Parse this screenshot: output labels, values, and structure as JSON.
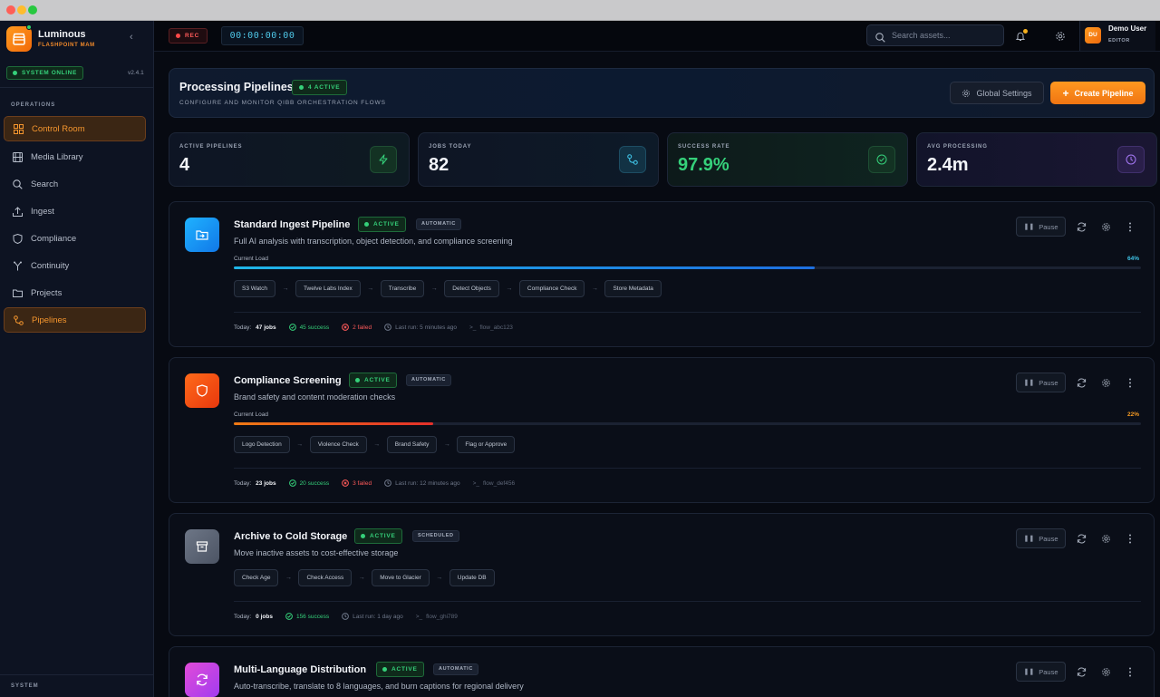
{
  "app": {
    "name": "Luminous",
    "subtitle": "FLASHPOINT MAM",
    "status": "SYSTEM ONLINE",
    "version": "v2.4.1"
  },
  "sidebar": {
    "section_label": "OPERATIONS",
    "items": [
      {
        "label": "Control Room",
        "icon": "grid-icon",
        "active": true
      },
      {
        "label": "Media Library",
        "icon": "film-icon",
        "active": false
      },
      {
        "label": "Search",
        "icon": "search-icon",
        "active": false
      },
      {
        "label": "Ingest",
        "icon": "upload-icon",
        "active": false
      },
      {
        "label": "Compliance",
        "icon": "shield-icon",
        "active": false
      },
      {
        "label": "Continuity",
        "icon": "branch-icon",
        "active": false
      },
      {
        "label": "Projects",
        "icon": "folder-icon",
        "active": false
      },
      {
        "label": "Pipelines",
        "icon": "workflow-icon",
        "active": true
      }
    ],
    "footer_label": "SYSTEM"
  },
  "topbar": {
    "rec_label": "REC",
    "timecode": "00:00:00:00",
    "search_placeholder": "Search assets...",
    "user": {
      "initials": "DU",
      "name": "Demo User",
      "role": "EDITOR"
    }
  },
  "header": {
    "title": "Processing Pipelines",
    "active_badge": "4 ACTIVE",
    "subtitle": "CONFIGURE AND MONITOR QIBB ORCHESTRATION FLOWS",
    "global_settings_label": "Global Settings",
    "create_label": "Create Pipeline"
  },
  "stats": [
    {
      "label": "ACTIVE PIPELINES",
      "value": "4",
      "icon": "bolt-icon",
      "color": "#35d07a"
    },
    {
      "label": "JOBS TODAY",
      "value": "82",
      "icon": "workflow-icon",
      "color": "#3fc3e6"
    },
    {
      "label": "SUCCESS RATE",
      "value": "97.9%",
      "icon": "check-circle-icon",
      "color": "#35d07a"
    },
    {
      "label": "AVG PROCESSING",
      "value": "2.4m",
      "icon": "clock-icon",
      "color": "#a578f5"
    }
  ],
  "pipelines": [
    {
      "name": "Standard Ingest Pipeline",
      "status": "ACTIVE",
      "mode": "AUTOMATIC",
      "description": "Full AI analysis with transcription, object detection, and compliance screening",
      "load_label": "Current Load",
      "load_pct": "64%",
      "load_value": 0.64,
      "steps": [
        "S3 Watch",
        "Twelve Labs Index",
        "Transcribe",
        "Detect Objects",
        "Compliance Check",
        "Store Metadata"
      ],
      "today_label": "Today:",
      "jobs": "47 jobs",
      "success": "45 success",
      "failed": "2 failed",
      "last_run": "Last run: 5 minutes ago",
      "flow": "flow_abc123",
      "icon": "folder-in-icon",
      "pause_label": "Pause"
    },
    {
      "name": "Compliance Screening",
      "status": "ACTIVE",
      "mode": "AUTOMATIC",
      "description": "Brand safety and content moderation checks",
      "load_label": "Current Load",
      "load_pct": "22%",
      "load_value": 0.22,
      "steps": [
        "Logo Detection",
        "Violence Check",
        "Brand Safety",
        "Flag or Approve"
      ],
      "today_label": "Today:",
      "jobs": "23 jobs",
      "success": "20 success",
      "failed": "3 failed",
      "last_run": "Last run: 12 minutes ago",
      "flow": "flow_def456",
      "icon": "shield-icon",
      "pause_label": "Pause"
    },
    {
      "name": "Archive to Cold Storage",
      "status": "ACTIVE",
      "mode": "SCHEDULED",
      "description": "Move inactive assets to cost-effective storage",
      "steps": [
        "Check Age",
        "Check Access",
        "Move to Glacier",
        "Update DB"
      ],
      "today_label": "Today:",
      "jobs": "0 jobs",
      "success": "156 success",
      "last_run": "Last run: 1 day ago",
      "flow": "flow_ghi789",
      "icon": "archive-icon",
      "pause_label": "Pause"
    },
    {
      "name": "Multi-Language Distribution",
      "status": "ACTIVE",
      "mode": "AUTOMATIC",
      "description": "Auto-transcribe, translate to 8 languages, and burn captions for regional delivery",
      "icon": "refresh-icon",
      "pause_label": "Pause"
    }
  ]
}
